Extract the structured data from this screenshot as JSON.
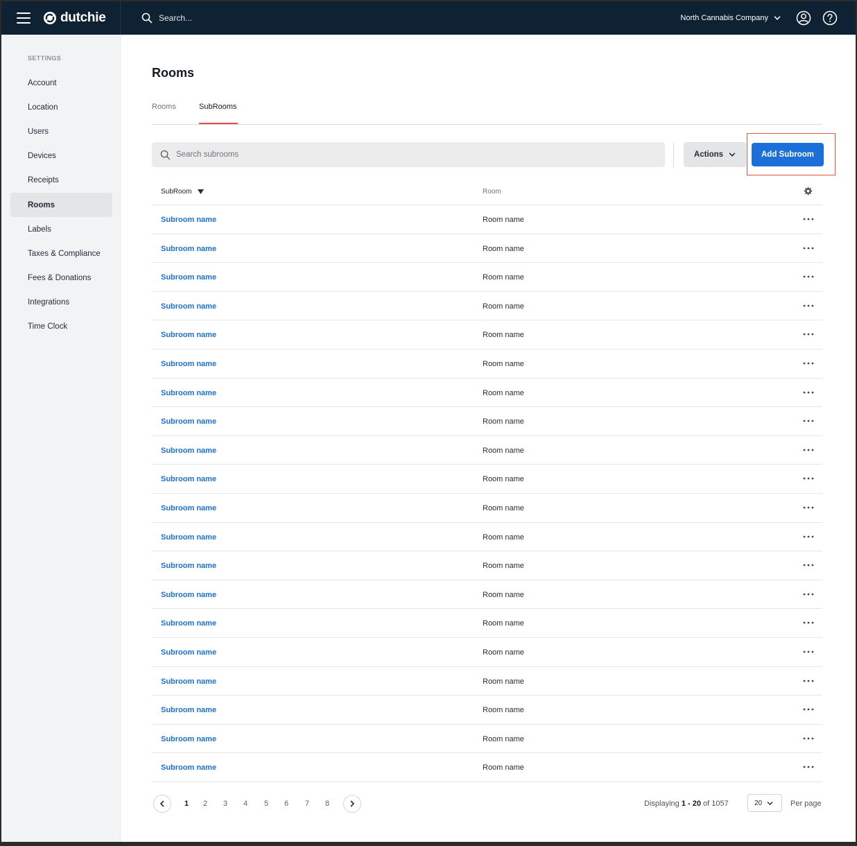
{
  "header": {
    "brand": "dutchie",
    "search_placeholder": "Search...",
    "company": "North Cannabis Company"
  },
  "sidebar": {
    "heading": "SETTINGS",
    "items": [
      {
        "label": "Account"
      },
      {
        "label": "Location"
      },
      {
        "label": "Users"
      },
      {
        "label": "Devices"
      },
      {
        "label": "Receipts"
      },
      {
        "label": "Rooms",
        "active": true
      },
      {
        "label": "Labels"
      },
      {
        "label": "Taxes & Compliance"
      },
      {
        "label": "Fees & Donations"
      },
      {
        "label": "Integrations"
      },
      {
        "label": "Time Clock"
      }
    ]
  },
  "page": {
    "title": "Rooms",
    "tabs": [
      {
        "label": "Rooms",
        "active": false
      },
      {
        "label": "SubRooms",
        "active": true
      }
    ]
  },
  "toolbar": {
    "search_placeholder": "Search subrooms",
    "actions_label": "Actions",
    "add_label": "Add Subroom"
  },
  "table": {
    "columns": [
      "SubRoom",
      "Room"
    ],
    "rows": [
      {
        "subroom": "Subroom name",
        "room": "Room name"
      },
      {
        "subroom": "Subroom name",
        "room": "Room name"
      },
      {
        "subroom": "Subroom name",
        "room": "Room name"
      },
      {
        "subroom": "Subroom name",
        "room": "Room name"
      },
      {
        "subroom": "Subroom name",
        "room": "Room name"
      },
      {
        "subroom": "Subroom name",
        "room": "Room name"
      },
      {
        "subroom": "Subroom name",
        "room": "Room name"
      },
      {
        "subroom": "Subroom name",
        "room": "Room name"
      },
      {
        "subroom": "Subroom name",
        "room": "Room name"
      },
      {
        "subroom": "Subroom name",
        "room": "Room name"
      },
      {
        "subroom": "Subroom name",
        "room": "Room name"
      },
      {
        "subroom": "Subroom name",
        "room": "Room name"
      },
      {
        "subroom": "Subroom name",
        "room": "Room name"
      },
      {
        "subroom": "Subroom name",
        "room": "Room name"
      },
      {
        "subroom": "Subroom name",
        "room": "Room name"
      },
      {
        "subroom": "Subroom name",
        "room": "Room name"
      },
      {
        "subroom": "Subroom name",
        "room": "Room name"
      },
      {
        "subroom": "Subroom name",
        "room": "Room name"
      },
      {
        "subroom": "Subroom name",
        "room": "Room name"
      },
      {
        "subroom": "Subroom name",
        "room": "Room name"
      }
    ]
  },
  "pagination": {
    "pages": [
      "1",
      "2",
      "3",
      "4",
      "5",
      "6",
      "7",
      "8"
    ],
    "current_page": "1",
    "displaying_prefix": "Displaying",
    "displaying_range": "1 - 20",
    "displaying_of": "of 1057",
    "per_page_value": "20",
    "per_page_label": "Per page"
  },
  "colors": {
    "topbar": "#0e2234",
    "primary": "#1c6fd9",
    "tab_underline": "#e54b4b",
    "highlight": "#e3533f"
  }
}
